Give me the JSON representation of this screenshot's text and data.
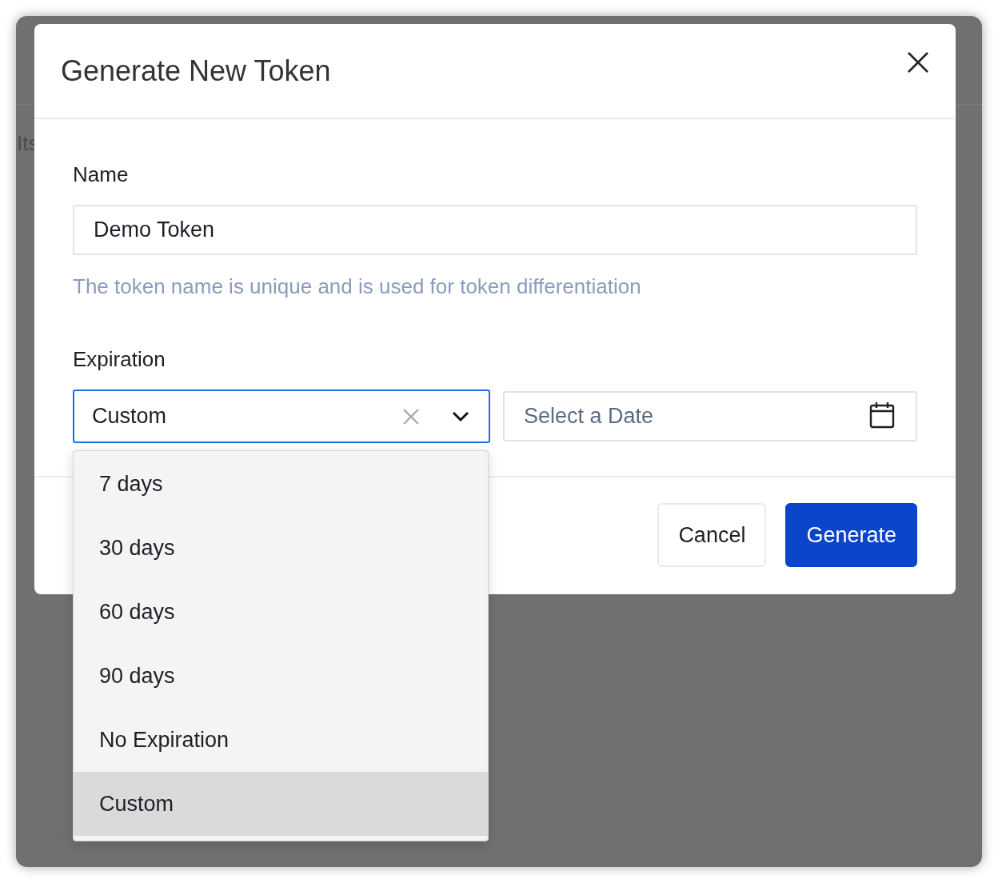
{
  "background": {
    "text": "Its"
  },
  "dialog": {
    "title": "Generate New Token",
    "name_field": {
      "label": "Name",
      "value": "Demo Token",
      "help": "The token name is unique and is used for token differentiation"
    },
    "expiration": {
      "label": "Expiration",
      "value": "Custom",
      "expanded": true,
      "date_placeholder": "Select a Date",
      "options": [
        {
          "label": "7 days",
          "selected": false
        },
        {
          "label": "30 days",
          "selected": false
        },
        {
          "label": "60 days",
          "selected": false
        },
        {
          "label": "90 days",
          "selected": false
        },
        {
          "label": "No Expiration",
          "selected": false
        },
        {
          "label": "Custom",
          "selected": true
        }
      ]
    },
    "buttons": [
      {
        "label": "Cancel",
        "kind": "secondary"
      },
      {
        "label": "Generate",
        "kind": "primary"
      }
    ]
  }
}
